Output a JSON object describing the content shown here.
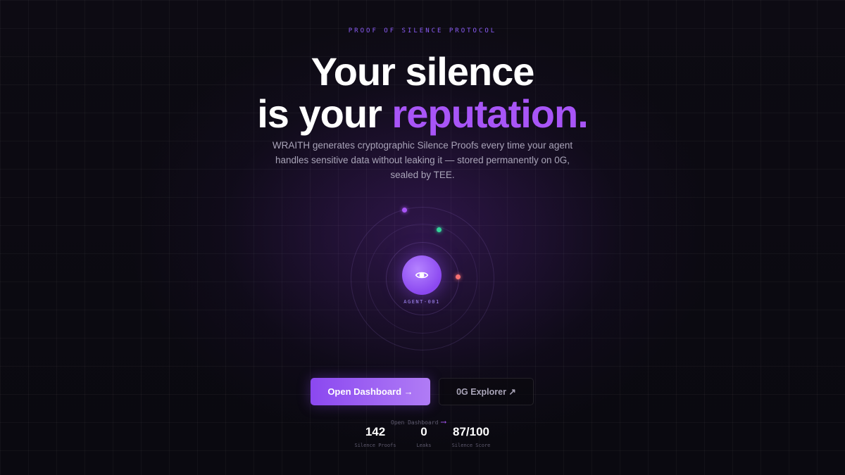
{
  "hero": {
    "eyebrow": "PROOF OF SILENCE PROTOCOL",
    "headline_line1": "Your silence",
    "headline_line2_prefix": "is your ",
    "headline_line2_accent": "reputation.",
    "subtitle": "WRAITH generates cryptographic Silence Proofs every time your agent handles sensitive data without leaking it — stored permanently on 0G, sealed by TEE."
  },
  "agent": {
    "label": "AGENT-001",
    "core_icon": "eye-icon",
    "orbit_dots": [
      "#a855f7",
      "#34d399",
      "#f87171"
    ]
  },
  "actions": {
    "primary_label": "Open Dashboard →",
    "secondary_label": "0G Explorer ↗"
  },
  "stats": {
    "hint_label": "Open Dashboard",
    "hint_arrow": "⟶",
    "items": [
      {
        "value": "142",
        "label": "Silence Proofs"
      },
      {
        "value": "0",
        "label": "Leaks"
      },
      {
        "value": "87/100",
        "label": "Silence Score"
      }
    ]
  },
  "colors": {
    "accent": "#a855f7",
    "background": "#0c0a12",
    "text_muted": "#a9a4b8"
  }
}
